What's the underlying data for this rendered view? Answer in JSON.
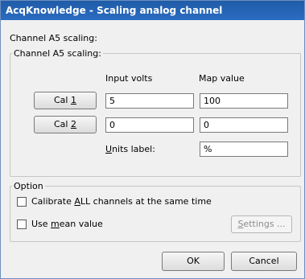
{
  "window": {
    "title": "AcqKnowledge - Scaling analog channel"
  },
  "header": {
    "label": "Channel A5 scaling:"
  },
  "scaling_group": {
    "legend": "Channel A5 scaling:",
    "col_input_volts": "Input volts",
    "col_map_value": "Map value",
    "rows": [
      {
        "button_prefix": "Cal ",
        "button_mnemonic": "1",
        "input_volts": "5",
        "map_value": "100"
      },
      {
        "button_prefix": "Cal ",
        "button_mnemonic": "2",
        "input_volts": "0",
        "map_value": "0"
      }
    ],
    "units_mnemonic": "U",
    "units_rest": "nits label:",
    "units_value": "%"
  },
  "option_group": {
    "legend": "Option",
    "calibrate_all": {
      "before": "Calibrate ",
      "mnemonic": "A",
      "after": "LL channels at the same time",
      "checked": false
    },
    "use_mean": {
      "before": "Use ",
      "mnemonic": "m",
      "after": "ean value",
      "checked": false
    },
    "settings": {
      "mnemonic": "S",
      "rest": "ettings ...",
      "enabled": false
    }
  },
  "footer": {
    "ok_label": "OK",
    "cancel_label": "Cancel"
  }
}
